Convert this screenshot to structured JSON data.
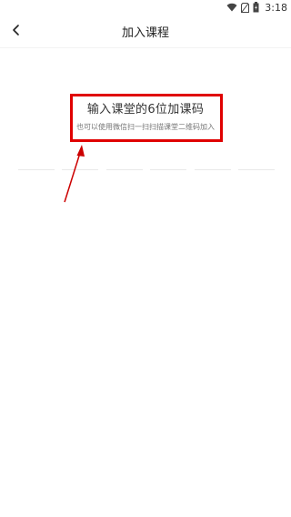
{
  "status_bar": {
    "time": "3:18",
    "icons": [
      "wifi-icon",
      "sim-icon",
      "battery-icon"
    ]
  },
  "nav": {
    "back_icon": "chevron-left-icon",
    "title": "加入课程"
  },
  "main": {
    "heading": "输入课堂的6位加课码",
    "subheading": "也可以使用微信扫一扫扫描课堂二维码加入",
    "code_length": 6
  },
  "annotation": {
    "box_color": "#e00000",
    "arrow_color": "#cc0000"
  }
}
